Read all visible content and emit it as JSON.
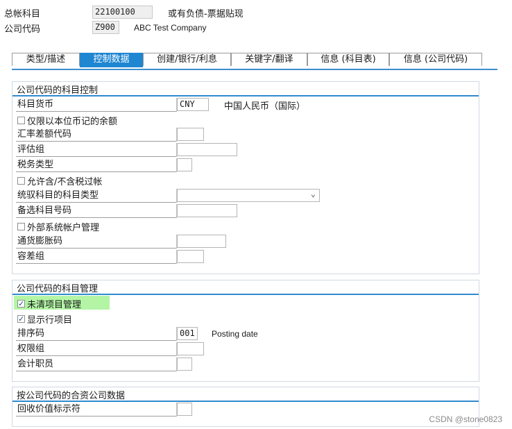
{
  "header": {
    "gl_account_label": "总帐科目",
    "gl_account_value": "22100100",
    "gl_account_desc": "或有负债-票据贴现",
    "company_code_label": "公司代码",
    "company_code_value": "Z900",
    "company_code_desc": "ABC Test Company"
  },
  "tabs": [
    {
      "label": "类型/描述",
      "active": false
    },
    {
      "label": "控制数据",
      "active": true
    },
    {
      "label": "创建/银行/利息",
      "active": false
    },
    {
      "label": "关键字/翻译",
      "active": false
    },
    {
      "label": "信息 (科目表)",
      "active": false
    },
    {
      "label": "信息 (公司代码)",
      "active": false
    }
  ],
  "account_control": {
    "title": "公司代码的科目控制",
    "account_currency_label": "科目货币",
    "account_currency_value": "CNY",
    "account_currency_desc": "中国人民币（国际）",
    "balances_local_only_label": "仅限以本位币记的余额",
    "balances_local_only_checked": false,
    "exchange_rate_diff_label": "汇率差额代码",
    "valuation_group_label": "评估组",
    "tax_category_label": "税务类型",
    "posting_without_tax_label": "允许含/不含税过帐",
    "posting_without_tax_checked": false,
    "recon_account_type_label": "统驭科目的科目类型",
    "alternative_account_label": "备选科目号码",
    "external_system_label": "外部系统帐户管理",
    "external_system_checked": false,
    "inflation_key_label": "通货膨胀码",
    "tolerance_group_label": "容差组"
  },
  "account_management": {
    "title": "公司代码的科目管理",
    "open_item_label": "未清项目管理",
    "open_item_checked": true,
    "line_items_label": "显示行项目",
    "line_items_checked": true,
    "sort_key_label": "排序码",
    "sort_key_value": "001",
    "sort_key_desc": "Posting date",
    "authorization_group_label": "权限组",
    "accounting_clerk_label": "会计职员"
  },
  "joint_venture": {
    "title": "按公司代码的合资公司数据",
    "recovery_indicator_label": "回收价值标示符"
  },
  "watermark": "CSDN @stone0823",
  "colors": {
    "accent": "#1f86d2",
    "highlight": "#b3f5a5",
    "group_rule": "#2f8ad0"
  }
}
